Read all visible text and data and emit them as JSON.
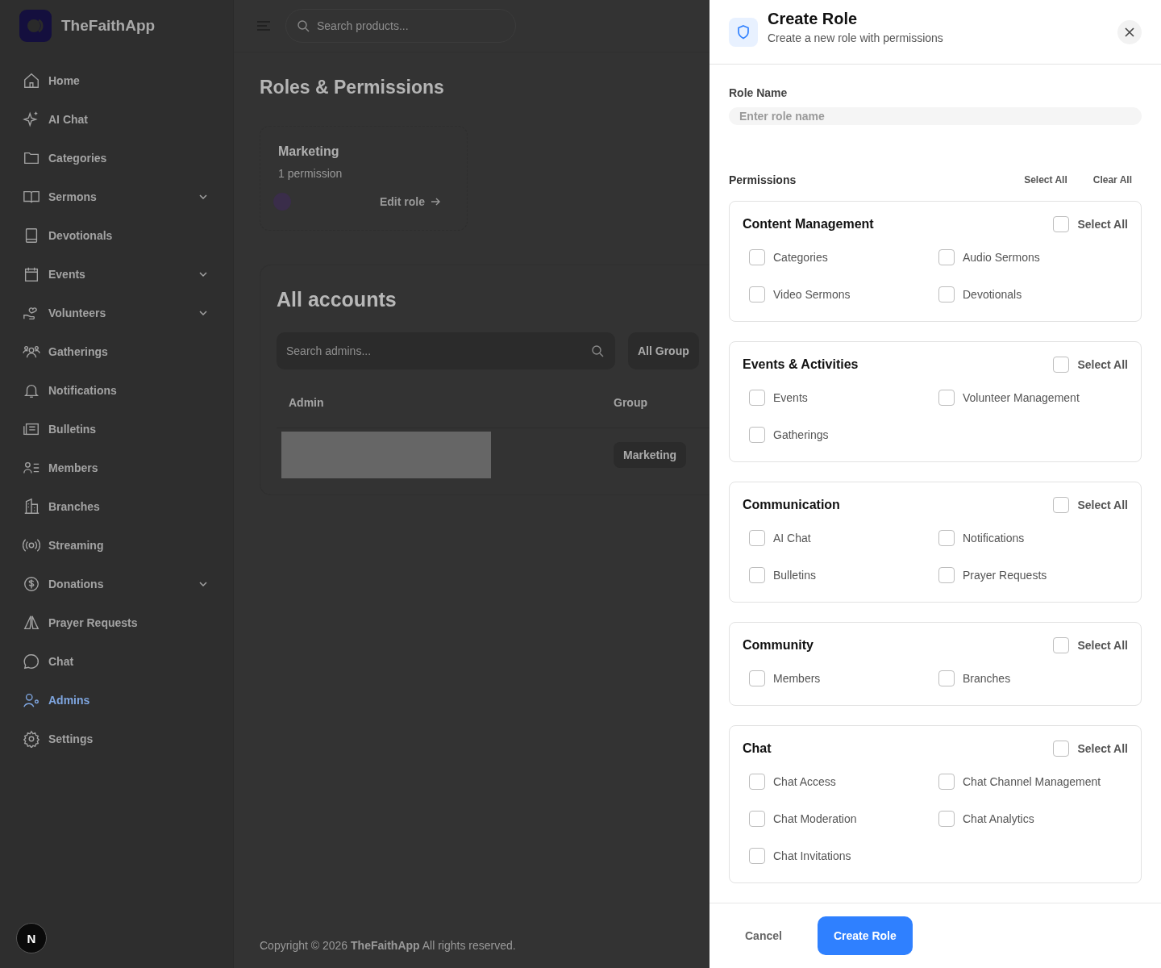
{
  "sidebar": {
    "brand": "TheFaithApp",
    "items": [
      {
        "label": "Home",
        "kind": "link",
        "selected": false
      },
      {
        "label": "AI Chat",
        "kind": "link",
        "selected": false
      },
      {
        "label": "Categories",
        "kind": "link",
        "selected": false
      },
      {
        "label": "Sermons",
        "kind": "group",
        "selected": false
      },
      {
        "label": "Devotionals",
        "kind": "link",
        "selected": false
      },
      {
        "label": "Events",
        "kind": "group",
        "selected": false
      },
      {
        "label": "Volunteers",
        "kind": "group",
        "selected": false
      },
      {
        "label": "Gatherings",
        "kind": "link",
        "selected": false
      },
      {
        "label": "Notifications",
        "kind": "link",
        "selected": false
      },
      {
        "label": "Bulletins",
        "kind": "link",
        "selected": false
      },
      {
        "label": "Members",
        "kind": "link",
        "selected": false
      },
      {
        "label": "Branches",
        "kind": "link",
        "selected": false
      },
      {
        "label": "Streaming",
        "kind": "link",
        "selected": false
      },
      {
        "label": "Donations",
        "kind": "group",
        "selected": false
      },
      {
        "label": "Prayer Requests",
        "kind": "link",
        "selected": false
      },
      {
        "label": "Chat",
        "kind": "link",
        "selected": false
      },
      {
        "label": "Admins",
        "kind": "link",
        "selected": true
      },
      {
        "label": "Settings",
        "kind": "link",
        "selected": false
      }
    ],
    "badge": "N"
  },
  "topbar": {
    "search": {
      "placeholder": "Search products..."
    }
  },
  "page": {
    "title": "Roles & Permissions",
    "role_card": {
      "name": "Marketing",
      "count": "1 permission",
      "link": "Edit role"
    },
    "accounts": {
      "title": "All accounts",
      "search": {
        "placeholder": "Search admins..."
      },
      "filter": "All Group",
      "columns": [
        "Admin",
        "Group"
      ],
      "rows": [
        {
          "group": "Marketing"
        }
      ]
    },
    "footer": {
      "text": "Copyright © 2026 **TheFaithApp** All rights reserved."
    }
  },
  "dialog": {
    "title": "Create Role",
    "subtitle": "Create a new role with permissions",
    "role_name": {
      "label": "Role Name",
      "placeholder": "Enter role name"
    },
    "permissions": {
      "label": "Permissions",
      "select_all": "Select All",
      "clear_all": "Clear All",
      "groups": [
        {
          "title": "Content Management",
          "select_all": "Select All",
          "checked": false,
          "items": [
            {
              "label": "Categories",
              "checked": false
            },
            {
              "label": "Audio Sermons",
              "checked": false
            },
            {
              "label": "Video Sermons",
              "checked": false
            },
            {
              "label": "Devotionals",
              "checked": false
            }
          ]
        },
        {
          "title": "Events & Activities",
          "select_all": "Select All",
          "checked": false,
          "items": [
            {
              "label": "Events",
              "checked": false
            },
            {
              "label": "Volunteer Management",
              "checked": false
            },
            {
              "label": "Gatherings",
              "checked": false
            }
          ]
        },
        {
          "title": "Communication",
          "select_all": "Select All",
          "checked": false,
          "items": [
            {
              "label": "AI Chat",
              "checked": false
            },
            {
              "label": "Notifications",
              "checked": false
            },
            {
              "label": "Bulletins",
              "checked": false
            },
            {
              "label": "Prayer Requests",
              "checked": false
            }
          ]
        },
        {
          "title": "Community",
          "select_all": "Select All",
          "checked": false,
          "items": [
            {
              "label": "Members",
              "checked": false
            },
            {
              "label": "Branches",
              "checked": false
            }
          ]
        },
        {
          "title": "Chat",
          "select_all": "Select All",
          "checked": false,
          "items": [
            {
              "label": "Chat Access",
              "checked": false
            },
            {
              "label": "Chat Channel Management",
              "checked": false
            },
            {
              "label": "Chat Moderation",
              "checked": false
            },
            {
              "label": "Chat Analytics",
              "checked": false
            },
            {
              "label": "Chat Invitations",
              "checked": false
            }
          ]
        }
      ]
    },
    "buttons": {
      "cancel": "Cancel",
      "submit": "Create Role"
    }
  }
}
